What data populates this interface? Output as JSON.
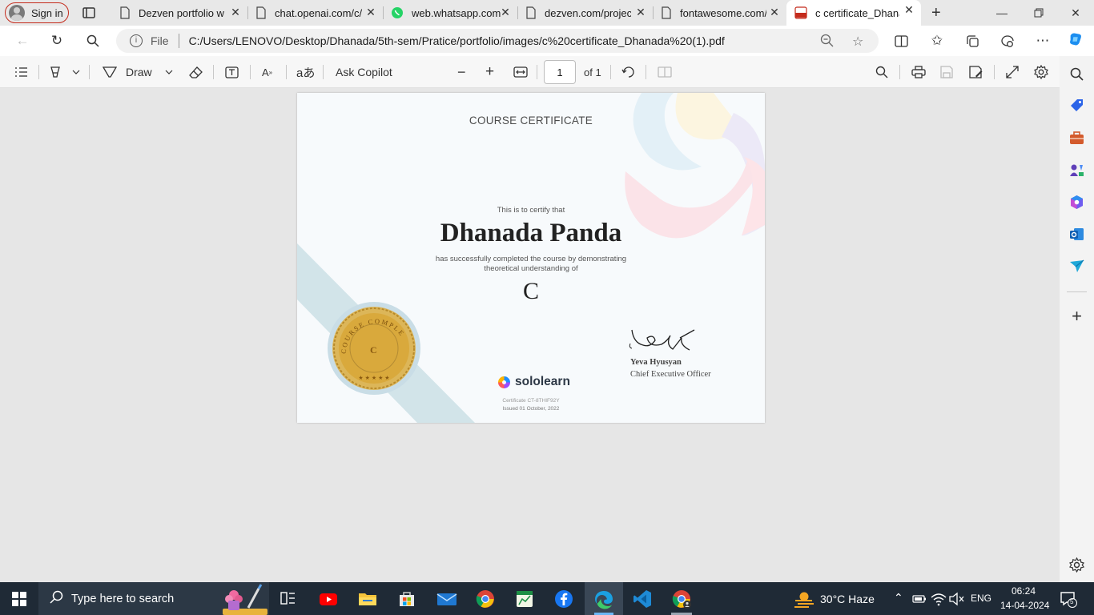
{
  "browser": {
    "profile_label": "Sign in",
    "tabs": [
      {
        "title": "Dezven portfolio w"
      },
      {
        "title": "chat.openai.com/c/"
      },
      {
        "title": "web.whatsapp.com"
      },
      {
        "title": "dezven.com/projec"
      },
      {
        "title": "fontawesome.com/"
      },
      {
        "title": "c certificate_Dhana"
      }
    ],
    "url_scheme_label": "File",
    "url": "C:/Users/LENOVO/Desktop/Dhanada/5th-sem/Pratice/portfolio/images/c%20certificate_Dhanada%20(1).pdf"
  },
  "pdf_toolbar": {
    "draw_label": "Draw",
    "ask_copilot_label": "Ask Copilot",
    "page_current": "1",
    "page_total_label": "of 1"
  },
  "certificate": {
    "heading": "COURSE CERTIFICATE",
    "certify_line": "This is to certify that",
    "recipient": "Dhanada Panda",
    "completion_line_1": "has successfully completed the course by demonstrating",
    "completion_line_2": "theoretical understanding of",
    "course": "C",
    "seal_text": "COURSE COMPLETED",
    "seal_letter": "C",
    "brand": "sololearn",
    "signer_name": "Yeva Hyusyan",
    "signer_title": "Chief Executive Officer",
    "certificate_id": "Certificate CT-8THIF92Y",
    "issued": "Issued 01 October, 2022"
  },
  "taskbar": {
    "search_placeholder": "Type here to search",
    "weather": "30°C  Haze",
    "language": "ENG",
    "time": "06:24",
    "date": "14-04-2024",
    "notification_count": "5"
  },
  "colors": {
    "tab_close_accent": "#c42b1c",
    "taskbar_bg": "#1f2a36",
    "seal_gold": "#d9a93c",
    "band_blue": "#cfe2e8"
  }
}
